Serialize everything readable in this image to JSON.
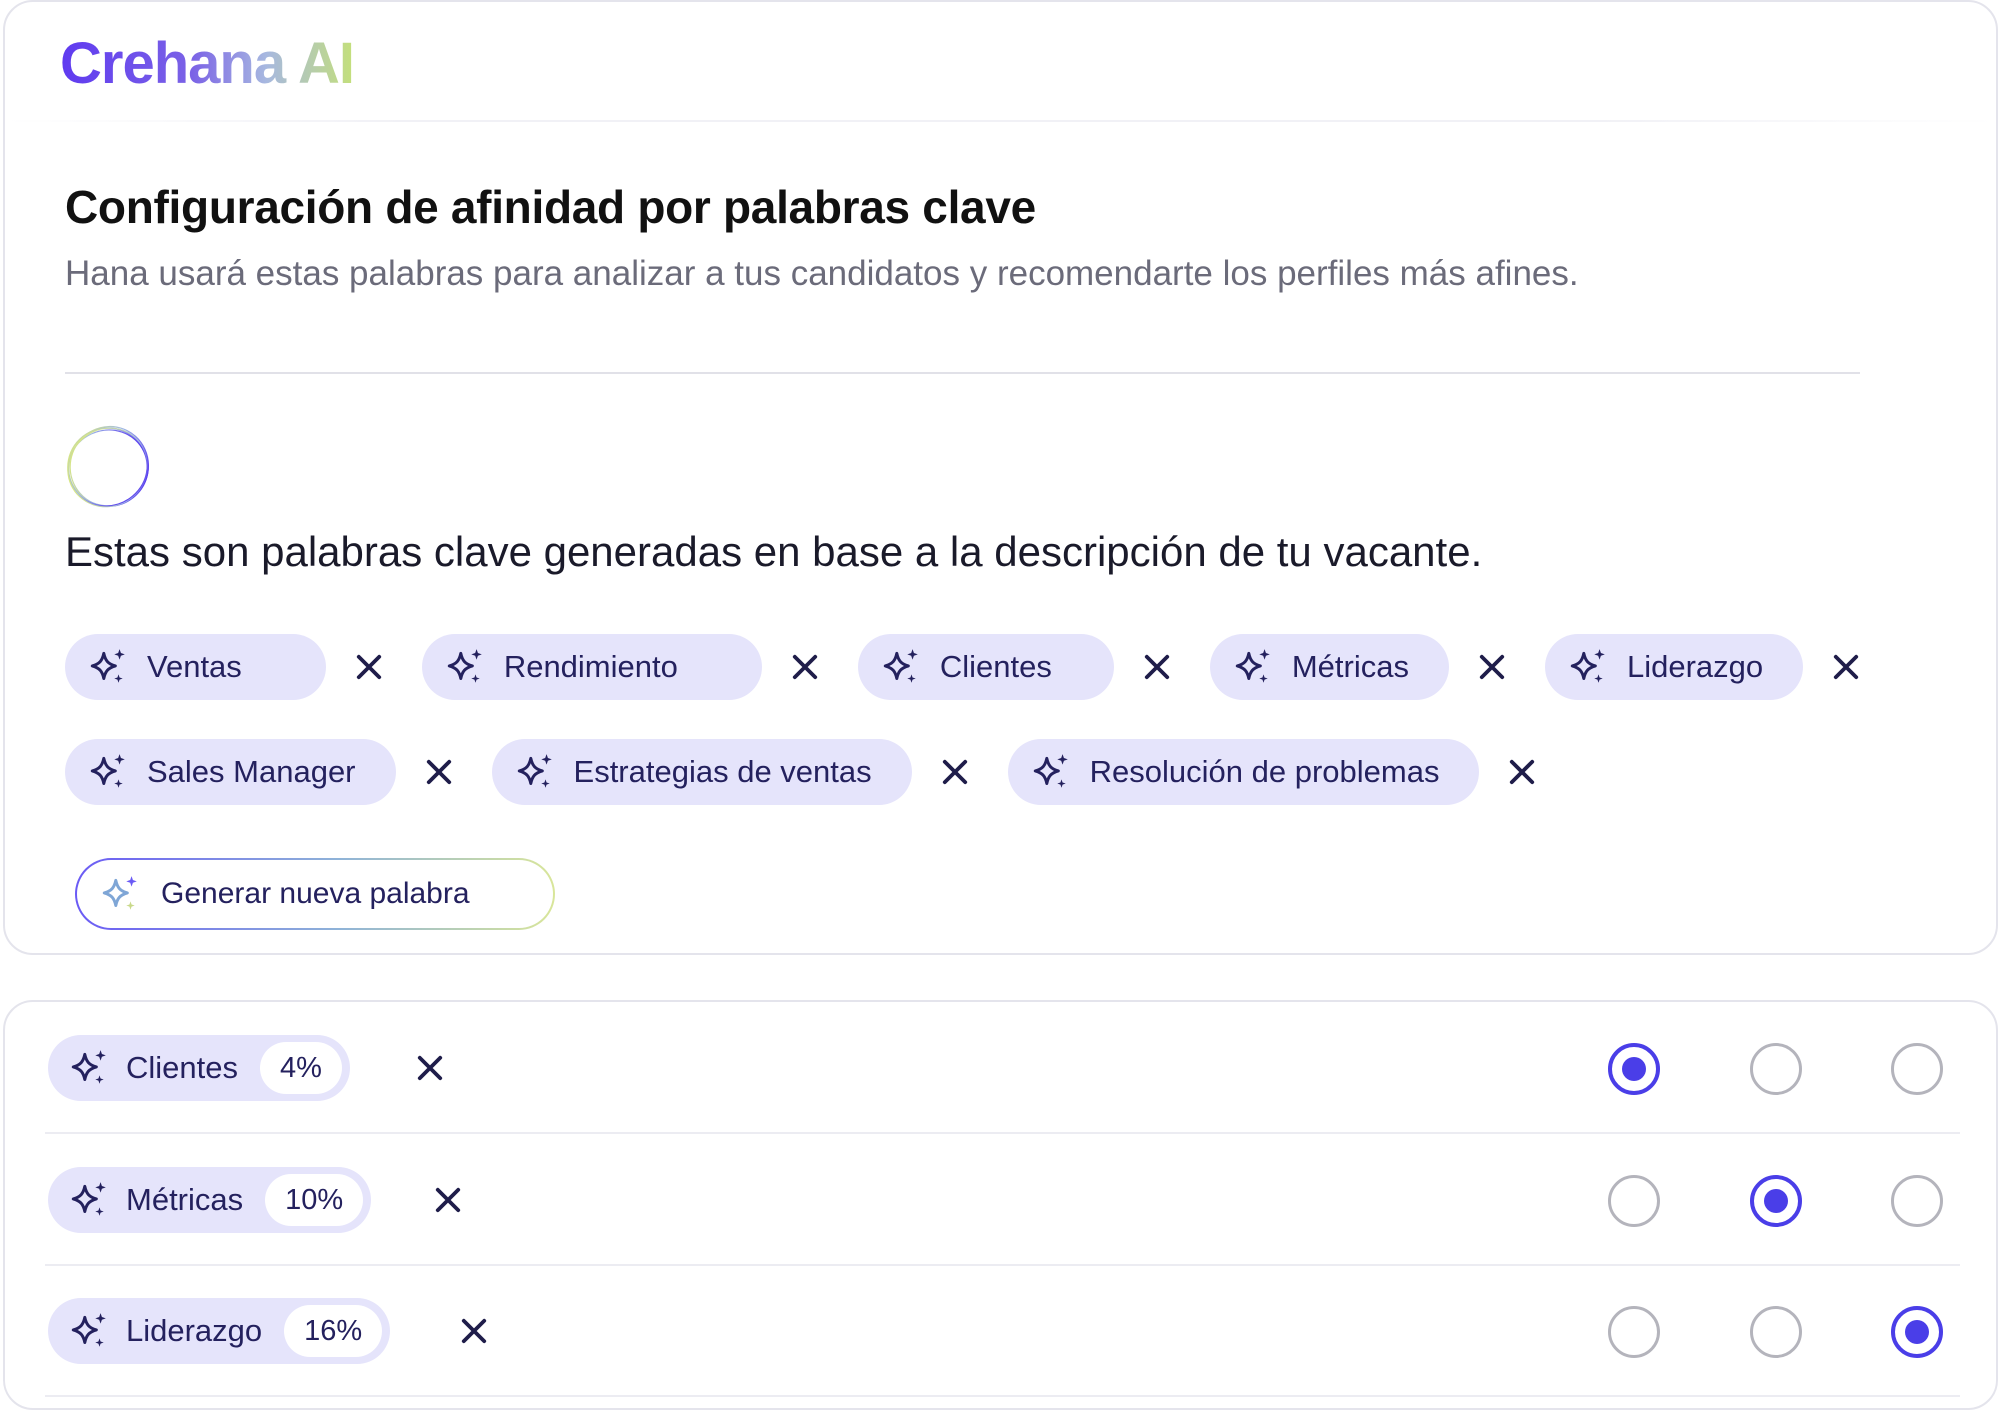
{
  "brand": {
    "name": "Crehana AI"
  },
  "header": {
    "title": "Configuración de afinidad por palabras clave",
    "subtitle": "Hana usará estas palabras para analizar a tus candidatos y recomendarte los perfiles más afines."
  },
  "keywords_section": {
    "intro": "Estas son palabras clave generadas en base a la descripción de tu vacante.",
    "chips": [
      {
        "label": "Ventas"
      },
      {
        "label": "Rendimiento"
      },
      {
        "label": "Clientes"
      },
      {
        "label": "Métricas"
      },
      {
        "label": "Liderazgo"
      },
      {
        "label": "Sales Manager"
      },
      {
        "label": "Estrategias de ventas"
      },
      {
        "label": "Resolución de problemas"
      }
    ],
    "generate_button": "Generar nueva palabra"
  },
  "weights": [
    {
      "label": "Clientes",
      "percent": "4%",
      "selected_option": 1
    },
    {
      "label": "Métricas",
      "percent": "10%",
      "selected_option": 2
    },
    {
      "label": "Liderazgo",
      "percent": "16%",
      "selected_option": 3
    }
  ],
  "colors": {
    "accent": "#4a3ee8",
    "chip_bg": "#e5e4fb",
    "chip_text": "#24215e"
  },
  "icons": {
    "chip": "sparkles-icon",
    "remove": "close-icon",
    "assistant": "ai-orb-icon"
  }
}
